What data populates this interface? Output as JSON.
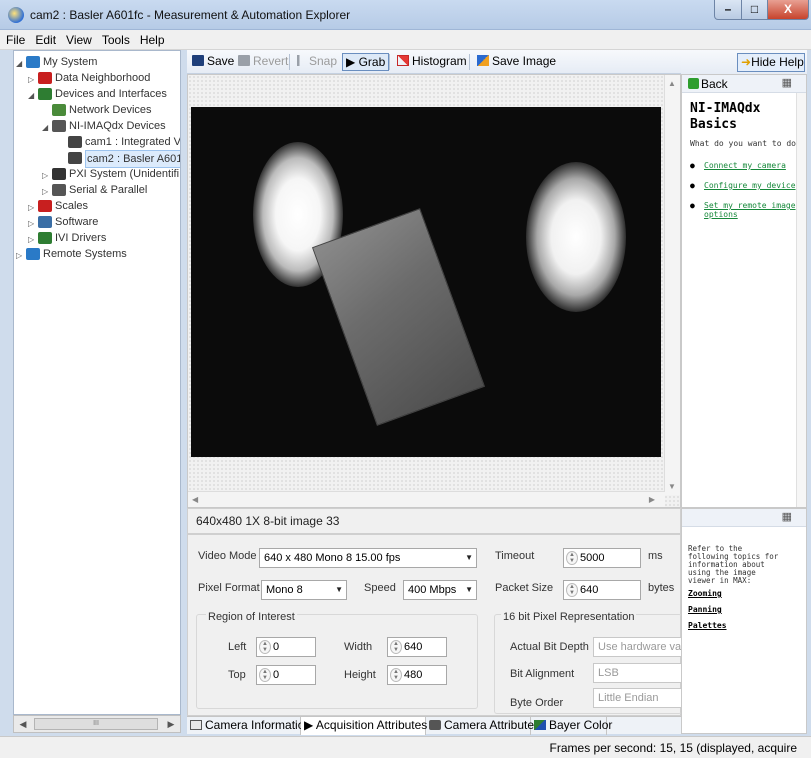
{
  "window": {
    "title": "cam2 : Basler A601fc - Measurement & Automation Explorer",
    "close_label": "X"
  },
  "menu": [
    "File",
    "Edit",
    "View",
    "Tools",
    "Help"
  ],
  "tree": {
    "items": [
      {
        "label": "My System",
        "level": 0,
        "expanded": true,
        "icon": "my-system-icon",
        "icon_color": "#2a7ac7"
      },
      {
        "label": "Data Neighborhood",
        "level": 1,
        "expanded": false,
        "icon": "data-neighborhood-icon",
        "icon_color": "#c81f1f"
      },
      {
        "label": "Devices and Interfaces",
        "level": 1,
        "expanded": true,
        "icon": "devices-icon",
        "icon_color": "#2e7d32"
      },
      {
        "label": "Network Devices",
        "level": 2,
        "expanded": null,
        "icon": "network-devices-icon",
        "icon_color": "#4a8b3a"
      },
      {
        "label": "NI-IMAQdx Devices",
        "level": 2,
        "expanded": true,
        "icon": "imaqdx-icon",
        "icon_color": "#555555"
      },
      {
        "label": "cam1 : Integrated V",
        "level": 3,
        "expanded": null,
        "icon": "camera-icon",
        "icon_color": "#444444"
      },
      {
        "label": "cam2 : Basler A601",
        "level": 3,
        "expanded": null,
        "icon": "firewire-camera-icon",
        "icon_color": "#444444",
        "selected": true
      },
      {
        "label": "PXI System (Unidentifi",
        "level": 2,
        "expanded": false,
        "icon": "pxi-icon",
        "icon_color": "#333333"
      },
      {
        "label": "Serial & Parallel",
        "level": 2,
        "expanded": false,
        "icon": "serial-icon",
        "icon_color": "#555555"
      },
      {
        "label": "Scales",
        "level": 1,
        "expanded": false,
        "icon": "scales-icon",
        "icon_color": "#c81f1f"
      },
      {
        "label": "Software",
        "level": 1,
        "expanded": false,
        "icon": "software-icon",
        "icon_color": "#3a6ea5"
      },
      {
        "label": "IVI Drivers",
        "level": 1,
        "expanded": false,
        "icon": "ivi-icon",
        "icon_color": "#2e7d32"
      },
      {
        "label": "Remote Systems",
        "level": 0,
        "expanded": false,
        "icon": "remote-systems-icon",
        "icon_color": "#2a7ac7"
      }
    ],
    "hscroll_thumb": "III"
  },
  "toolbar": {
    "save": "Save",
    "revert": "Revert",
    "snap": "Snap",
    "grab": "Grab",
    "histogram": "Histogram",
    "save_image": "Save Image"
  },
  "viewer": {
    "info": "640x480  1X  8-bit image  33"
  },
  "settings": {
    "video_mode_label": "Video Mode",
    "video_mode_value": "640 x 480 Mono 8 15.00 fps",
    "timeout_label": "Timeout",
    "timeout_value": "5000",
    "timeout_unit": "ms",
    "pixel_format_label": "Pixel Format",
    "pixel_format_value": "Mono 8",
    "speed_label": "Speed",
    "speed_value": "400 Mbps",
    "packet_size_label": "Packet Size",
    "packet_size_value": "640",
    "packet_size_unit": "bytes",
    "roi_title": "Region of Interest",
    "left_label": "Left",
    "left_value": "0",
    "width_label": "Width",
    "width_value": "640",
    "top_label": "Top",
    "top_value": "0",
    "height_label": "Height",
    "height_value": "480",
    "pixel_rep_title": "16 bit Pixel Representation",
    "actual_bit_depth_label": "Actual Bit Depth",
    "actual_bit_depth_value": "Use hardware value",
    "bit_alignment_label": "Bit Alignment",
    "bit_alignment_value": "LSB",
    "byte_order_label": "Byte Order",
    "byte_order_value": "Little Endian"
  },
  "tabs": [
    {
      "label": "Camera Information",
      "active": false
    },
    {
      "label": "Acquisition Attributes",
      "active": true
    },
    {
      "label": "Camera Attributes",
      "active": false
    },
    {
      "label": "Bayer Color",
      "active": false
    }
  ],
  "help": {
    "hide_help": "Hide Help",
    "back": "Back",
    "heading": "NI-IMAQdx Basics",
    "question": "What do you want to do?",
    "links": [
      "Connect my camera",
      "Configure my device",
      "Set my remote image options"
    ],
    "lower_text": "Refer to the following topics for information about using the image viewer in MAX:",
    "lower_links": [
      "Zooming",
      "Panning",
      "Palettes"
    ]
  },
  "status": {
    "fps": "Frames per second: 15, 15 (displayed, acquire"
  },
  "colors": {
    "help_link": "#16883a",
    "selection": "#dcebfc",
    "title_bar": "#c9daf0"
  }
}
